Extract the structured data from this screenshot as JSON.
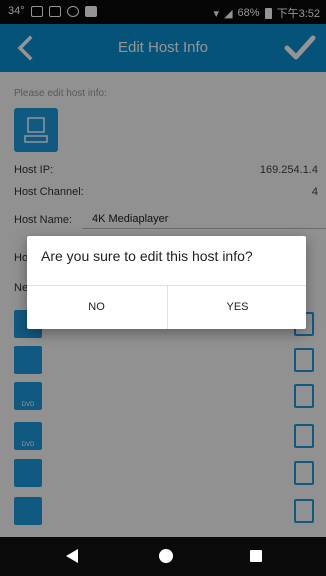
{
  "status_bar": {
    "temperature": "34°",
    "battery": "68%",
    "time": "下午3:52"
  },
  "header": {
    "title": "Edit Host Info",
    "back_icon": "back-arrow-icon",
    "confirm_icon": "checkmark-icon"
  },
  "form": {
    "hint": "Please edit host info:",
    "host_ip_label": "Host IP:",
    "host_ip_value": "169.254.1.4",
    "host_channel_label": "Host Channel:",
    "host_channel_value": "4",
    "host_name_label": "Host Name:",
    "host_name_value": "4K Mediaplayer",
    "partial_label_1": "Ho",
    "partial_label_2": "Ne"
  },
  "device_list": [
    {
      "icon": "stb-icon",
      "label": ""
    },
    {
      "icon": "hdmi-device-icon",
      "label": ""
    },
    {
      "icon": "dvd-icon",
      "label": "DVD"
    },
    {
      "icon": "dvd-icon",
      "label": "DVD"
    },
    {
      "icon": "stb-icon",
      "label": ""
    },
    {
      "icon": "stb-icon",
      "label": ""
    }
  ],
  "dialog": {
    "message": "Are you sure to edit this host info?",
    "no_label": "NO",
    "yes_label": "YES"
  },
  "colors": {
    "accent": "#0b8fd3",
    "icon_blue": "#1c9be0"
  }
}
